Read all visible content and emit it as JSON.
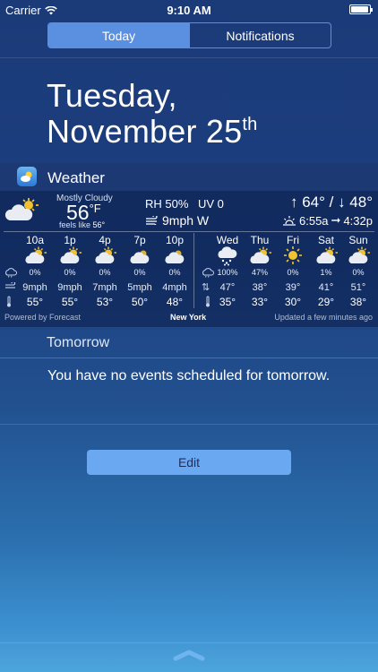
{
  "status_bar": {
    "carrier": "Carrier",
    "time": "9:10 AM",
    "battery_level": 0.95
  },
  "tabs": [
    {
      "label": "Today",
      "active": true
    },
    {
      "label": "Notifications",
      "active": false
    }
  ],
  "date": {
    "weekday": "Tuesday,",
    "month_day": "November 25",
    "suffix": "th"
  },
  "weather": {
    "app_title": "Weather",
    "condition": "Mostly Cloudy",
    "temp": "56",
    "unit": "°F",
    "feels_like_label": "feels like",
    "feels_like_value": "56°",
    "rh": "RH 50%",
    "uv": "UV 0",
    "wind": "9mph W",
    "hi_lo": "↑ 64° / ↓ 48°",
    "sunrise": "6:55a",
    "sunset": "4:32p",
    "hourly": [
      {
        "time": "10a",
        "icon": "partly-cloudy-day-icon",
        "precip": "0%",
        "wind": "9mph",
        "temp": "55°"
      },
      {
        "time": "1p",
        "icon": "partly-cloudy-day-icon",
        "precip": "0%",
        "wind": "9mph",
        "temp": "55°"
      },
      {
        "time": "4p",
        "icon": "partly-cloudy-day-icon",
        "precip": "0%",
        "wind": "7mph",
        "temp": "53°"
      },
      {
        "time": "7p",
        "icon": "cloudy-icon",
        "precip": "0%",
        "wind": "5mph",
        "temp": "50°"
      },
      {
        "time": "10p",
        "icon": "cloudy-icon",
        "precip": "0%",
        "wind": "4mph",
        "temp": "48°"
      }
    ],
    "daily": [
      {
        "day": "Wed",
        "icon": "snow-icon",
        "precip": "100%",
        "hi": "47°",
        "lo": "35°"
      },
      {
        "day": "Thu",
        "icon": "partly-cloudy-day-icon",
        "precip": "47%",
        "hi": "38°",
        "lo": "33°"
      },
      {
        "day": "Fri",
        "icon": "sun-icon",
        "precip": "0%",
        "hi": "39°",
        "lo": "30°"
      },
      {
        "day": "Sat",
        "icon": "partly-cloudy-day-icon",
        "precip": "1%",
        "hi": "41°",
        "lo": "29°"
      },
      {
        "day": "Sun",
        "icon": "partly-cloudy-day-icon",
        "precip": "0%",
        "hi": "51°",
        "lo": "38°"
      }
    ],
    "powered_by": "Powered by Forecast",
    "location": "New York",
    "updated": "Updated a few minutes ago"
  },
  "tomorrow": {
    "heading": "Tomorrow",
    "message": "You have no events scheduled for tomorrow."
  },
  "edit_label": "Edit"
}
